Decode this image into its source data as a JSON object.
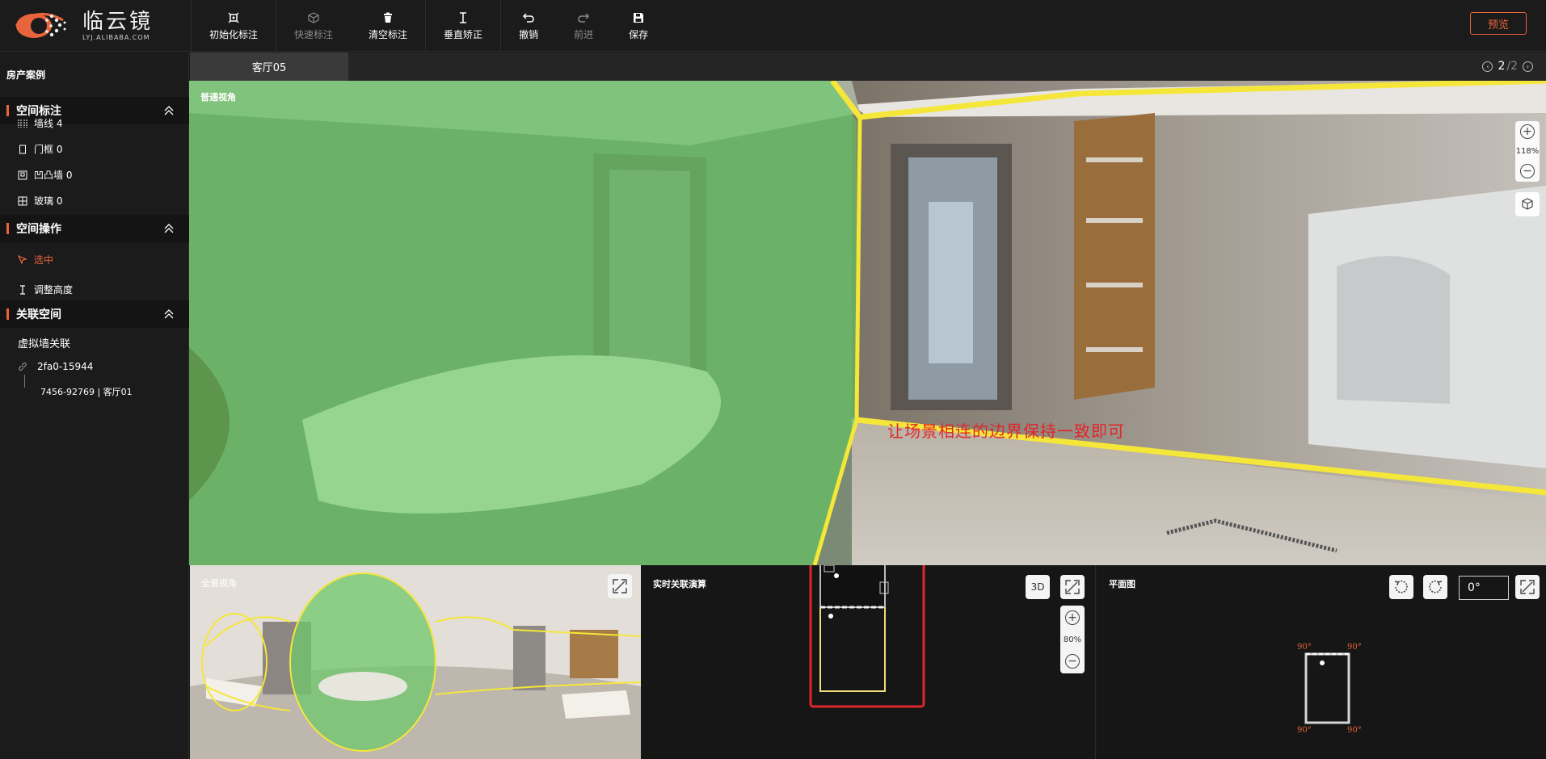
{
  "app": {
    "logo_cn": "临云镜",
    "logo_en": "LYJ.ALIBABA.COM"
  },
  "toolbar": {
    "init": "初始化标注",
    "quick": "快速标注",
    "clear": "清空标注",
    "vertical": "垂直矫正",
    "undo": "撤销",
    "redo": "前进",
    "save": "保存",
    "preview": "预览"
  },
  "sidebar": {
    "title": "房产案例",
    "space_marking": {
      "header": "空间标注",
      "items": [
        {
          "label": "墙线 4",
          "icon": "wall-line-icon"
        },
        {
          "label": "门框 0",
          "icon": "door-frame-icon"
        },
        {
          "label": "凹凸墙 0",
          "icon": "concave-wall-icon"
        },
        {
          "label": "玻璃 0",
          "icon": "glass-icon"
        }
      ]
    },
    "space_ops": {
      "header": "空间操作",
      "items": [
        {
          "label": "选中",
          "icon": "pointer-icon",
          "active": true
        },
        {
          "label": "调整高度",
          "icon": "height-icon",
          "active": false
        }
      ]
    },
    "linked_space": {
      "header": "关联空间",
      "subtitle": "虚拟墙关联",
      "link_id": "2fa0-15944",
      "link_target": "7456-92769 | 客厅01"
    }
  },
  "scene": {
    "tab": "客厅05",
    "page_current": "2",
    "page_sep": "/",
    "page_total": "2"
  },
  "main_view": {
    "label": "普通视角",
    "zoom": "118%",
    "annotation": "让场景相连的边界保持一致即可"
  },
  "panorama": {
    "label": "全景视角"
  },
  "live_calc": {
    "title": "实时关联演算",
    "btn_3d": "3D",
    "zoom": "80%"
  },
  "floor_plan": {
    "title": "平面图",
    "angle": "0°",
    "corner_angle": "90°"
  },
  "colors": {
    "accent": "#e8643c",
    "highlight_green": "#5fd35f",
    "wall_yellow": "#f5e63a",
    "annotation_red": "#e0262a"
  }
}
